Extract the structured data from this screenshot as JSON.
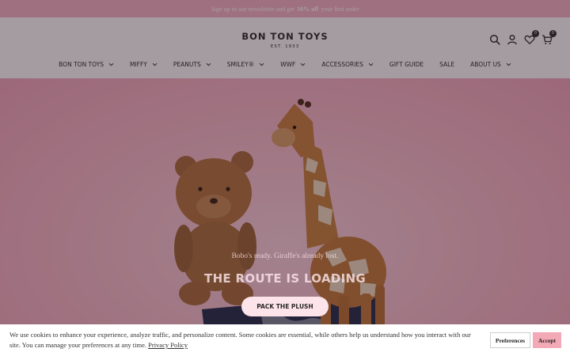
{
  "announcement": {
    "prefix": "Sign up to our newsletter and get",
    "highlight": "10% off",
    "suffix": "your first order"
  },
  "header": {
    "logo_name": "BON TON TOYS",
    "logo_est": "EST. 1933",
    "wishlist_count": "0",
    "cart_count": "0",
    "icons": [
      "search-icon",
      "account-icon",
      "heart-icon",
      "cart-icon"
    ]
  },
  "nav": {
    "items": [
      {
        "label": "BON TON TOYS",
        "has_dropdown": true
      },
      {
        "label": "MIFFY",
        "has_dropdown": true
      },
      {
        "label": "PEANUTS",
        "has_dropdown": true
      },
      {
        "label": "SMILEY®",
        "has_dropdown": true
      },
      {
        "label": "WWF",
        "has_dropdown": true
      },
      {
        "label": "ACCESSORIES",
        "has_dropdown": true
      },
      {
        "label": "GIFT GUIDE",
        "has_dropdown": false
      },
      {
        "label": "SALE",
        "has_dropdown": false
      },
      {
        "label": "ABOUT US",
        "has_dropdown": true
      }
    ]
  },
  "hero": {
    "subtitle": "Bobo's ready. Giraffe's already lost.",
    "title": "THE ROUTE IS LOADING",
    "button_label": "PACK THE PLUSH"
  },
  "cookie": {
    "text": "We use cookies to enhance your experience, analyze traffic, and personalize content. Some cookies are essential, while others help us understand how you interact with our site. You can manage your preferences at any time.",
    "policy_link": "Privacy Policy",
    "preferences_label": "Preferences",
    "accept_label": "Accept"
  },
  "colors": {
    "announcement_bg": "#f4b4c4",
    "hero_bg": "#f7b9c9",
    "accept_bg": "#f4a9b6",
    "text_dark": "#2a2a2a"
  }
}
